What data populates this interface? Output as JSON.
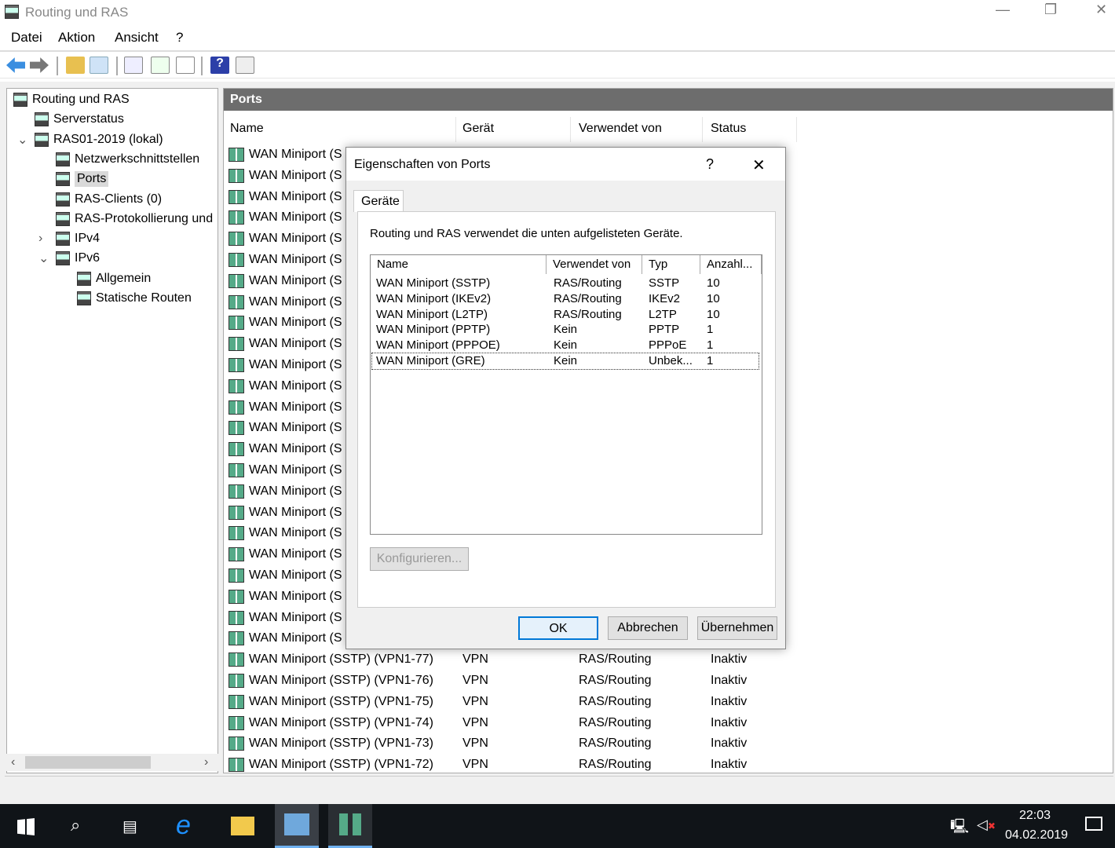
{
  "window": {
    "title": "Routing und RAS",
    "minimize": "—",
    "restore": "❐",
    "close": "✕"
  },
  "menu": [
    "Datei",
    "Aktion",
    "Ansicht",
    "?"
  ],
  "toolbar": [
    "back-icon",
    "forward-icon",
    "up-folder-icon",
    "show-hide-tree-icon",
    "properties-icon",
    "refresh-icon",
    "export-icon",
    "help-icon",
    "action-pane-icon"
  ],
  "tree": [
    {
      "label": "Routing und RAS",
      "level": 0
    },
    {
      "label": "Serverstatus",
      "level": 1
    },
    {
      "label": "RAS01-2019 (lokal)",
      "level": 1,
      "expander": "⌄"
    },
    {
      "label": "Netzwerkschnittstellen",
      "level": 2
    },
    {
      "label": "Ports",
      "level": 2,
      "selected": true
    },
    {
      "label": "RAS-Clients (0)",
      "level": 2
    },
    {
      "label": "RAS-Protokollierung und",
      "level": 2
    },
    {
      "label": "IPv4",
      "level": 2,
      "expander": "›"
    },
    {
      "label": "IPv6",
      "level": 2,
      "expander": "⌄"
    },
    {
      "label": "Allgemein",
      "level": 3
    },
    {
      "label": "Statische Routen",
      "level": 3
    }
  ],
  "main": {
    "header": "Ports",
    "columns": [
      "Name",
      "Gerät",
      "Verwendet von",
      "Status"
    ],
    "hidden_row_name": "WAN Miniport (S",
    "rows": [
      {
        "name": "WAN Miniport (SSTP) (VPN1-77)",
        "device": "VPN",
        "used_by": "RAS/Routing",
        "status": "Inaktiv"
      },
      {
        "name": "WAN Miniport (SSTP) (VPN1-76)",
        "device": "VPN",
        "used_by": "RAS/Routing",
        "status": "Inaktiv"
      },
      {
        "name": "WAN Miniport (SSTP) (VPN1-75)",
        "device": "VPN",
        "used_by": "RAS/Routing",
        "status": "Inaktiv"
      },
      {
        "name": "WAN Miniport (SSTP) (VPN1-74)",
        "device": "VPN",
        "used_by": "RAS/Routing",
        "status": "Inaktiv"
      },
      {
        "name": "WAN Miniport (SSTP) (VPN1-73)",
        "device": "VPN",
        "used_by": "RAS/Routing",
        "status": "Inaktiv"
      },
      {
        "name": "WAN Miniport (SSTP) (VPN1-72)",
        "device": "VPN",
        "used_by": "RAS/Routing",
        "status": "Inaktiv"
      }
    ]
  },
  "dialog": {
    "title": "Eigenschaften von Ports",
    "help": "?",
    "close": "✕",
    "tab": "Geräte",
    "description": "Routing und RAS verwendet die unten aufgelisteten Geräte.",
    "columns": [
      "Name",
      "Verwendet von",
      "Typ",
      "Anzahl..."
    ],
    "rows": [
      {
        "name": "WAN Miniport (SSTP)",
        "used_by": "RAS/Routing",
        "type": "SSTP",
        "count": "10"
      },
      {
        "name": "WAN Miniport (IKEv2)",
        "used_by": "RAS/Routing",
        "type": "IKEv2",
        "count": "10"
      },
      {
        "name": "WAN Miniport (L2TP)",
        "used_by": "RAS/Routing",
        "type": "L2TP",
        "count": "10"
      },
      {
        "name": "WAN Miniport (PPTP)",
        "used_by": "Kein",
        "type": "PPTP",
        "count": "1"
      },
      {
        "name": "WAN Miniport (PPPOE)",
        "used_by": "Kein",
        "type": "PPPoE",
        "count": "1"
      },
      {
        "name": "WAN Miniport (GRE)",
        "used_by": "Kein",
        "type": "Unbek...",
        "count": "1"
      }
    ],
    "configure": "Konfigurieren...",
    "ok": "OK",
    "cancel": "Abbrechen",
    "apply": "Übernehmen"
  },
  "taskbar": {
    "time": "22:03",
    "date": "04.02.2019"
  }
}
